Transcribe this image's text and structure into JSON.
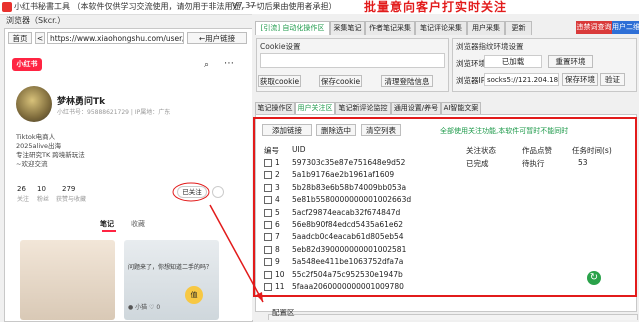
{
  "window": {
    "title": "小红书秘書工具 （本软件仅供学习交流使用，请勿用于非法用途，一切后果由使用者承担）",
    "version": "V7.37",
    "overlay_title": "批量意向客户打实时关注"
  },
  "browser": {
    "label": "浏览器（Skcr.）",
    "home_button": "首页",
    "back_button": "<",
    "address": "https://www.xiaohongshu.com/user/p",
    "user_link_button": "←用户链接"
  },
  "xhs_profile": {
    "logo": "小红书",
    "icon_a": "⌕",
    "icon_b": "⋯",
    "nickname": "梦林勇问Tk",
    "id_line": "小红书号：95888621729 | IP属地：广东",
    "bio": [
      "Tiktok电商人",
      "2025alive出海",
      "专注研究TK 跨境新玩法",
      "~欢迎交流"
    ],
    "stats": [
      {
        "num": "26",
        "label": "关注"
      },
      {
        "num": "10",
        "label": "粉丝"
      },
      {
        "num": "279",
        "label": "获赞与收藏"
      }
    ],
    "followed_button": "已关注",
    "tabs": {
      "notes": "笔记",
      "favorites": "收藏"
    },
    "thumb_text": "问题来了，你想知道二手的吗？",
    "thumb_emoji": "值",
    "thumb_mini": "● 小猫 ♡ 0"
  },
  "top_tabs": [
    {
      "label": "[引流] 自动化操作区",
      "active": true
    },
    {
      "label": "采集笔记",
      "active": false
    },
    {
      "label": "作者笔记采集",
      "active": false
    },
    {
      "label": "笔记评论采集",
      "active": false
    },
    {
      "label": "用户采集",
      "active": false
    },
    {
      "label": "更新",
      "active": false
    }
  ],
  "top_buttons": {
    "command_query": "违禁词查询",
    "user_2": "用户二维码"
  },
  "cookie": {
    "label": "Cookie设置",
    "get_button": "获取cookie",
    "save_button": "保存cookie",
    "clear_button": "清理登陆信息"
  },
  "env": {
    "label": "浏览器指纹环境设置",
    "env_label": "浏览环境：",
    "env_value": "已加载",
    "reset_button": "重置环境",
    "ip_label": "浏览器IP:",
    "ip_value": "socks5://121.204.18",
    "save_button": "保存环境",
    "verify_button": "验证"
  },
  "sub_tabs": [
    {
      "label": "笔记操作区",
      "active": false
    },
    {
      "label": "用户关注区",
      "active": true
    },
    {
      "label": "笔记新评论监控",
      "active": false
    },
    {
      "label": "通用设置/养号",
      "active": false
    },
    {
      "label": "AI智能文案",
      "active": false
    }
  ],
  "follow_tools": {
    "add_link": "添加链接",
    "delete_selected": "删除选中",
    "clear_list": "清空列表",
    "tip": "全部使用关注功能,本软件可暂时不能同时"
  },
  "table": {
    "headers": [
      "编号",
      "UID",
      "关注状态",
      "作品点赞",
      "任务时间(s)"
    ],
    "rows": [
      [
        "1",
        "597303c35e87e751648e9d52",
        "已完成",
        "待执行",
        "53"
      ],
      [
        "2",
        "5a1b9176ae2b1961af1609",
        "",
        "",
        ""
      ],
      [
        "3",
        "5b28b83e6b58b74009bb053a",
        "",
        "",
        ""
      ],
      [
        "4",
        "5e81b5580000000001002663d",
        "",
        "",
        ""
      ],
      [
        "5",
        "5acf29874eacab32f674847d",
        "",
        "",
        ""
      ],
      [
        "6",
        "56e8b90f84edcd5435a61e62",
        "",
        "",
        ""
      ],
      [
        "7",
        "5aadcb0c4eacab61d805eb54",
        "",
        "",
        ""
      ],
      [
        "8",
        "5eb82d390000000001002581",
        "",
        "",
        ""
      ],
      [
        "9",
        "5a548ee411be1063752dfa7a",
        "",
        "",
        ""
      ],
      [
        "10",
        "55c2f504a75c952530e1947b",
        "",
        "",
        ""
      ],
      [
        "11",
        "5faaa2060000000001009780",
        "",
        "",
        ""
      ]
    ]
  },
  "config_label": "配置区",
  "colors": {
    "accent_red": "#e21b1b",
    "active_tab": "#1d9a4a",
    "xhs_brand": "#ff2442"
  }
}
